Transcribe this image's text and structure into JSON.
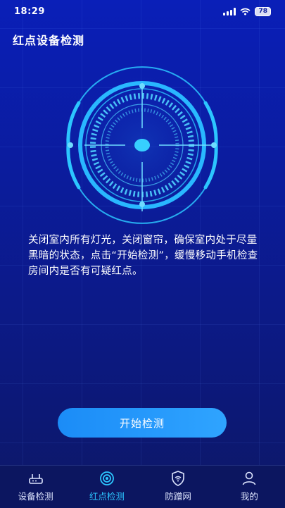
{
  "status_bar": {
    "time": "18:29",
    "battery": "78"
  },
  "page": {
    "title": "红点设备检测"
  },
  "description": "关闭室内所有灯光，关闭窗帘，确保室内处于尽量黑暗的状态，点击“开始检测”，缓慢移动手机检查房间内是否有可疑红点。",
  "start_button": {
    "label": "开始检测"
  },
  "tabs": [
    {
      "label": "设备检测",
      "icon": "router-icon",
      "active": false
    },
    {
      "label": "红点检测",
      "icon": "target-icon",
      "active": true
    },
    {
      "label": "防蹭网",
      "icon": "shield-wifi-icon",
      "active": false
    },
    {
      "label": "我的",
      "icon": "person-icon",
      "active": false
    }
  ],
  "colors": {
    "accent": "#2cc6ff",
    "button": "#1b8cf7",
    "background": "#0b1c9c",
    "tab_bar": "#0c1660"
  }
}
